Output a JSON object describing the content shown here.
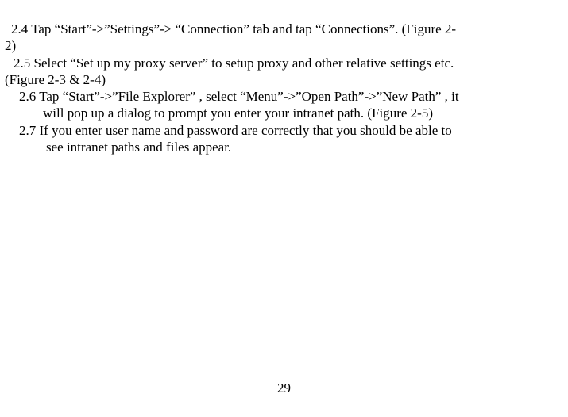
{
  "lines": {
    "l24a": "  2.4 Tap “Start”->”Settings”-> “Connection” tab and tap “Connections”. (Figure 2-",
    "l24b": "2)",
    "l25a": "  2.5 Select “Set up my proxy server” to setup proxy and other relative settings etc.",
    "l25b": "(Figure 2-3 & 2-4)",
    "l26a": "2.6 Tap “Start”->”File Explorer” , select “Menu”->”Open Path”->”New Path” , it",
    "l26b": "will pop up a dialog to prompt you enter your intranet path. (Figure 2-5)",
    "l27a": "2.7 If you enter user name and password are correctly that you should be able to",
    "l27b": "see intranet paths and files appear."
  },
  "page_number": "29"
}
